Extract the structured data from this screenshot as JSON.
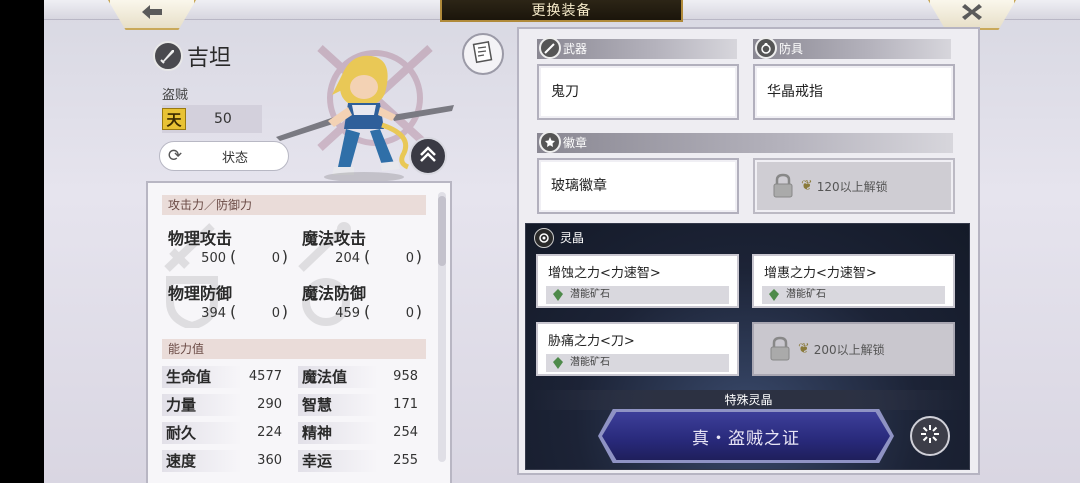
{
  "header": {
    "title": "更换装备",
    "back_icon": "back-arrow-icon",
    "close_icon": "close-icon"
  },
  "character": {
    "name": "吉坦",
    "job": "盗贼",
    "level_badge": "天",
    "level": "50",
    "status_button": "状态"
  },
  "stats": {
    "attack_defense_header": "攻击力／防御力",
    "cells": [
      {
        "name": "物理攻击",
        "value": "500",
        "paren_open": "(",
        "bonus": "0",
        "paren_close": ")"
      },
      {
        "name": "魔法攻击",
        "value": "204",
        "paren_open": "(",
        "bonus": "0",
        "paren_close": ")"
      },
      {
        "name": "物理防御",
        "value": "394",
        "paren_open": "(",
        "bonus": "0",
        "paren_close": ")"
      },
      {
        "name": "魔法防御",
        "value": "459",
        "paren_open": "(",
        "bonus": "0",
        "paren_close": ")"
      }
    ],
    "ability_header": "能力值",
    "abilities": [
      {
        "name": "生命值",
        "value": "4577"
      },
      {
        "name": "魔法值",
        "value": "958"
      },
      {
        "name": "力量",
        "value": "290"
      },
      {
        "name": "智慧",
        "value": "171"
      },
      {
        "name": "耐久",
        "value": "224"
      },
      {
        "name": "精神",
        "value": "254"
      },
      {
        "name": "速度",
        "value": "360"
      },
      {
        "name": "幸运",
        "value": "255"
      }
    ]
  },
  "equipment": {
    "weapon_label": "武器",
    "weapon_item": "鬼刀",
    "armor_label": "防具",
    "armor_item": "华晶戒指",
    "badge_label": "徽章",
    "badge_item": "玻璃徽章",
    "badge_locked_text": "120以上解锁"
  },
  "crystals": {
    "label": "灵晶",
    "slots": [
      {
        "name": "增蚀之力<力速智>",
        "sub": "潜能矿石"
      },
      {
        "name": "增惠之力<力速智>",
        "sub": "潜能矿石"
      },
      {
        "name": "胁痛之力<刀>",
        "sub": "潜能矿石"
      }
    ],
    "locked_text": "200以上解锁",
    "special_label": "特殊灵晶",
    "special_button": "真・盗贼之证"
  },
  "colors": {
    "title_bg": "#1b150b",
    "gold_border": "#b08a3a",
    "special_button": "#28297a",
    "panel_bg": "#eeedf2"
  }
}
